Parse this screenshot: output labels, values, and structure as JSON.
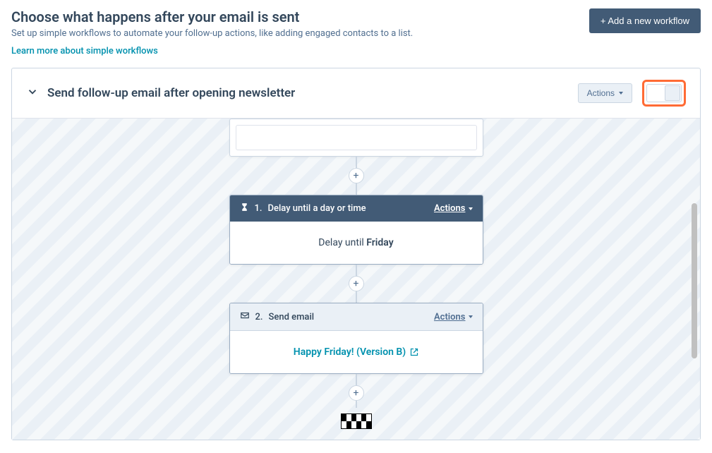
{
  "header": {
    "title": "Choose what happens after your email is sent",
    "subtitle": "Set up simple workflows to automate your follow-up actions, like adding engaged contacts to a list.",
    "learn_link": "Learn more about simple workflows",
    "add_button": "+ Add a new workflow"
  },
  "workflow": {
    "name": "Send follow-up email after opening newsletter",
    "actions_label": "Actions",
    "toggle_on": false
  },
  "steps": {
    "delay": {
      "index": "1.",
      "title": "Delay until a day or time",
      "actions_label": "Actions",
      "body_prefix": "Delay until ",
      "body_value": "Friday"
    },
    "send": {
      "index": "2.",
      "title": "Send email",
      "actions_label": "Actions",
      "email_name": "Happy Friday! (Version B)"
    }
  },
  "icons": {
    "plus": "+",
    "hourglass": "hourglass-icon",
    "envelope": "envelope-icon",
    "external": "external-link-icon",
    "chevron_down": "chevron-down-icon"
  },
  "colors": {
    "teal": "#0091ae",
    "navy": "#425b76",
    "panel_bg": "#eaf0f6",
    "highlight_orange": "#ff6b35"
  }
}
